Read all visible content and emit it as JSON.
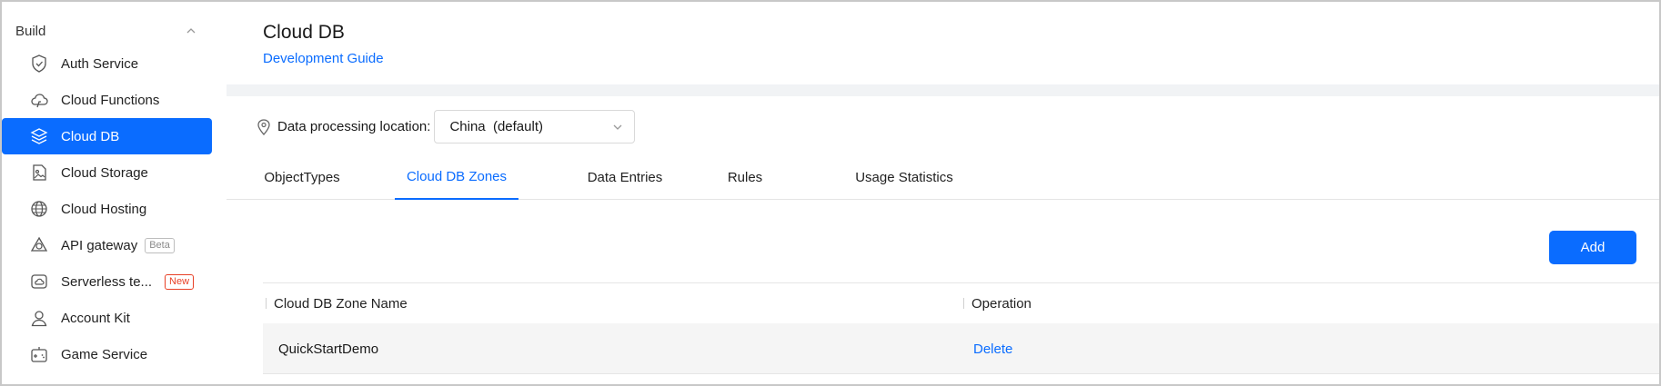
{
  "sidebar": {
    "group_label": "Build",
    "items": [
      {
        "label": "Auth Service",
        "icon": "shield-icon"
      },
      {
        "label": "Cloud Functions",
        "icon": "cloud-functions-icon"
      },
      {
        "label": "Cloud DB",
        "icon": "database-layers-icon"
      },
      {
        "label": "Cloud Storage",
        "icon": "storage-image-icon"
      },
      {
        "label": "Cloud Hosting",
        "icon": "globe-icon"
      },
      {
        "label": "API gateway",
        "icon": "gateway-icon",
        "badge": "Beta"
      },
      {
        "label": "Serverless te...",
        "icon": "serverless-cloud-icon",
        "badge": "New"
      },
      {
        "label": "Account Kit",
        "icon": "user-icon"
      },
      {
        "label": "Game Service",
        "icon": "gamepad-icon"
      }
    ],
    "active_index": 2
  },
  "header": {
    "title": "Cloud DB",
    "guide_link": "Development Guide"
  },
  "location": {
    "label": "Data processing location:",
    "selected": "China  (default)"
  },
  "tabs": [
    "ObjectTypes",
    "Cloud DB Zones",
    "Data Entries",
    "Rules",
    "Usage Statistics"
  ],
  "active_tab": 1,
  "toolbar": {
    "add_label": "Add"
  },
  "table": {
    "columns": [
      "Cloud DB Zone Name",
      "Operation"
    ],
    "rows": [
      {
        "name": "QuickStartDemo",
        "operation": "Delete"
      }
    ]
  },
  "colors": {
    "accent": "#0a6cff",
    "new_badge": "#e84026"
  }
}
